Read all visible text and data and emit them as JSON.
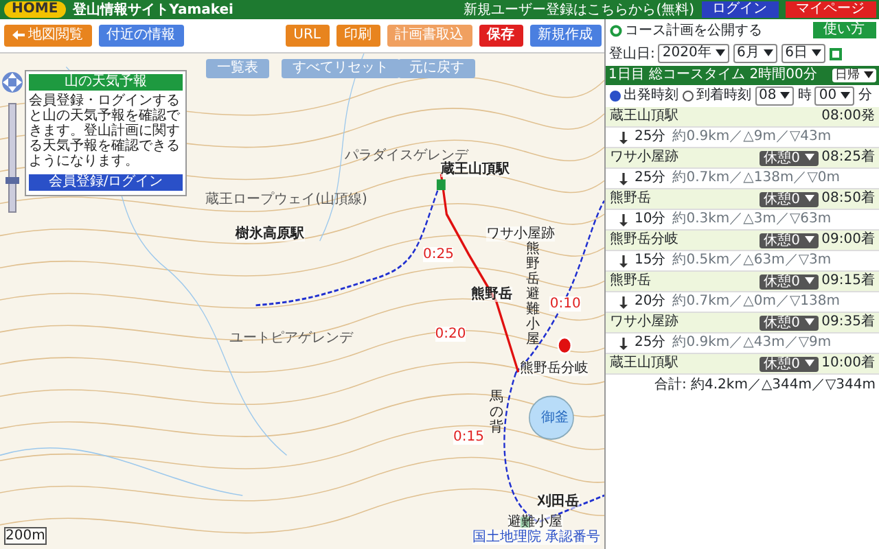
{
  "topbar": {
    "home": "HOME",
    "site_title": "登山情報サイトYamakei",
    "register_link": "新規ユーザー登録はこちらから(無料)",
    "login_button": "ログイン",
    "mypage_button": "マイページ"
  },
  "toolbar": {
    "left_buttons": [
      {
        "label": "地図閲覧",
        "kind": "back"
      },
      {
        "label": "付近の情報",
        "kind": "info"
      }
    ],
    "right_buttons": [
      {
        "label": "URL",
        "kind": "plain"
      },
      {
        "label": "印刷",
        "kind": "plain"
      },
      {
        "label": "計画書取込",
        "kind": "light"
      },
      {
        "label": "保存",
        "kind": "save"
      },
      {
        "label": "新規作成",
        "kind": "new"
      }
    ]
  },
  "plan": {
    "public_label": "コース計画を公開する",
    "help_button": "使い方",
    "date_label": "登山日:",
    "year": "2020年",
    "month": "6月",
    "day": "6日"
  },
  "map": {
    "buttons": [
      "一覧表",
      "すべてリセット",
      "元に戻す"
    ],
    "weather": {
      "title": "山の天気予報",
      "text": "会員登録・ログインすると山の天気予報を確認できます。登山計画に関する天気予報を確認できるようになります。",
      "button": "会員登録/ログイン"
    },
    "zoom": {
      "level": 0.3
    },
    "labels": [
      {
        "text": "蔵王山頂駅",
        "kind": "station"
      },
      {
        "text": "ワサ小屋跡",
        "kind": "place"
      },
      {
        "text": "熊野岳",
        "kind": "peak"
      },
      {
        "text": "熊野岳避難小屋",
        "kind": "vertical"
      },
      {
        "text": "熊野岳分岐",
        "kind": "place"
      },
      {
        "text": "馬の背",
        "kind": "vertical"
      },
      {
        "text": "御釜",
        "kind": "lake"
      },
      {
        "text": "刈田岳",
        "kind": "peak"
      },
      {
        "text": "避難小屋",
        "kind": "place"
      },
      {
        "text": "樹氷高原駅",
        "kind": "station"
      },
      {
        "text": "ユートピアゲレンデ",
        "kind": "minor"
      },
      {
        "text": "パラダイスゲレンデ",
        "kind": "minor"
      },
      {
        "text": "蔵王ロープウェイ(山頂線)",
        "kind": "minor"
      },
      {
        "text": "0:25",
        "kind": "time"
      },
      {
        "text": "0:20",
        "kind": "time"
      },
      {
        "text": "0:10",
        "kind": "time"
      },
      {
        "text": "0:15",
        "kind": "time"
      }
    ],
    "scale": "200m",
    "attribution": "国土地理院 承認番号"
  },
  "schedule": {
    "header": "1日目 総コースタイム 2時間00分",
    "mode_select": "日帰",
    "time_options": [
      {
        "label": "出発時刻",
        "selected": true
      },
      {
        "label": "到着時刻",
        "selected": false
      }
    ],
    "hour": "08",
    "hour_unit": "時",
    "minute": "00",
    "minute_unit": "分",
    "rows": [
      {
        "kind": "stop",
        "name": "蔵王山頂駅",
        "time": "08:00発"
      },
      {
        "kind": "leg",
        "duration": "25分",
        "detail": "約0.9km／△9m／▽43m"
      },
      {
        "kind": "stop",
        "name": "ワサ小屋跡",
        "rest": "休憩0",
        "time": "08:25着"
      },
      {
        "kind": "leg",
        "duration": "25分",
        "detail": "約0.7km／△138m／▽0m"
      },
      {
        "kind": "stop",
        "name": "熊野岳",
        "rest": "休憩0",
        "time": "08:50着"
      },
      {
        "kind": "leg",
        "duration": "10分",
        "detail": "約0.3km／△3m／▽63m"
      },
      {
        "kind": "stop",
        "name": "熊野岳分岐",
        "rest": "休憩0",
        "time": "09:00着"
      },
      {
        "kind": "leg",
        "duration": "15分",
        "detail": "約0.5km／△63m／▽3m"
      },
      {
        "kind": "stop",
        "name": "熊野岳",
        "rest": "休憩0",
        "time": "09:15着"
      },
      {
        "kind": "leg",
        "duration": "20分",
        "detail": "約0.7km／△0m／▽138m"
      },
      {
        "kind": "stop",
        "name": "ワサ小屋跡",
        "rest": "休憩0",
        "time": "09:35着"
      },
      {
        "kind": "leg",
        "duration": "25分",
        "detail": "約0.9km／△43m／▽9m"
      },
      {
        "kind": "stop",
        "name": "蔵王山頂駅",
        "rest": "休憩0",
        "time": "10:00着"
      }
    ],
    "total": "合計: 約4.2km／△344m／▽344m"
  }
}
